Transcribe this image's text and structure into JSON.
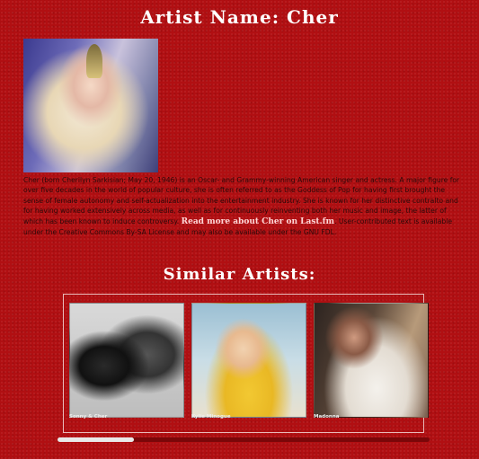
{
  "header": {
    "title": "Artist Name: Cher"
  },
  "artist": {
    "image_alt": "Cher",
    "bio_text": "Cher (born Cherilyn Sarkisian; May 20, 1946) is an Oscar- and Grammy-winning American singer and actress. A major figure for over five decades in the world of popular culture, she is often referred to as the Goddess of Pop for having first brought the sense of female autonomy and self-actualization into the entertainment industry. She is known for her distinctive contralto and for having worked extensively across media, as well as for continuously reinventing both her music and image, the latter of which has been known to induce controversy.",
    "read_more_label": "Read more about Cher on Last.fm",
    "license_text": ". User-contributed text is available under the Creative Commons By-SA License and may also be available under the GNU FDL."
  },
  "similar": {
    "title": "Similar Artists:",
    "artists": [
      {
        "name": "Sonny & Cher"
      },
      {
        "name": "Kylie Minogue"
      },
      {
        "name": "Madonna"
      }
    ]
  },
  "colors": {
    "background": "#b10f12",
    "text_dark": "#2a0a0a",
    "heading": "#ffffff"
  }
}
